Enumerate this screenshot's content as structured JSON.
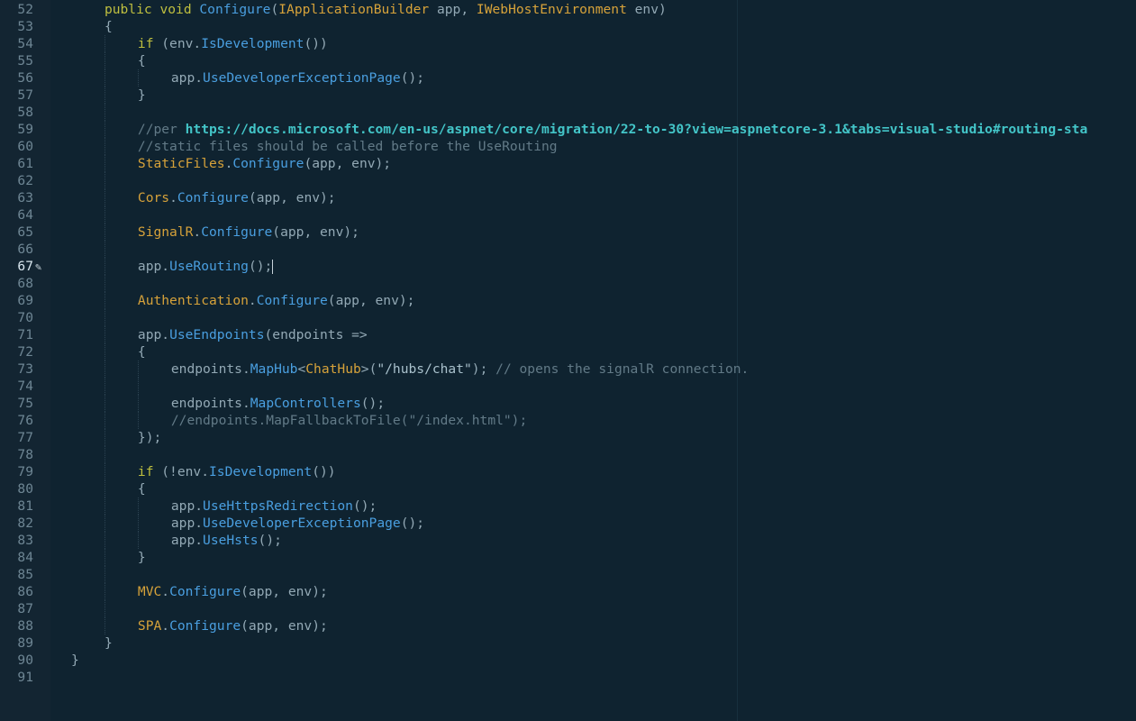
{
  "editor": {
    "active_line": 67,
    "colors": {
      "background": "#0f2330",
      "gutter": "#132532",
      "keyword": "#bfbf3f",
      "type": "#d6a23a",
      "method": "#4a9fe0",
      "comment": "#627a87",
      "url": "#43c5c8"
    },
    "lines": [
      {
        "n": "52",
        "indent": 1,
        "tokens": [
          [
            "kw",
            "public void "
          ],
          [
            "fn",
            "Configure"
          ],
          [
            "pl",
            "("
          ],
          [
            "ty",
            "IApplicationBuilder"
          ],
          [
            "pl",
            " app, "
          ],
          [
            "ty",
            "IWebHostEnvironment"
          ],
          [
            "pl",
            " env)"
          ]
        ]
      },
      {
        "n": "53",
        "indent": 1,
        "tokens": [
          [
            "pl",
            "{"
          ]
        ]
      },
      {
        "n": "54",
        "indent": 2,
        "tokens": [
          [
            "kw",
            "if"
          ],
          [
            "pl",
            " (env."
          ],
          [
            "fn",
            "IsDevelopment"
          ],
          [
            "pl",
            "())"
          ]
        ]
      },
      {
        "n": "55",
        "indent": 2,
        "tokens": [
          [
            "pl",
            "{"
          ]
        ]
      },
      {
        "n": "56",
        "indent": 3,
        "tokens": [
          [
            "pl",
            "app."
          ],
          [
            "fn",
            "UseDeveloperExceptionPage"
          ],
          [
            "pl",
            "();"
          ]
        ]
      },
      {
        "n": "57",
        "indent": 2,
        "tokens": [
          [
            "pl",
            "}"
          ]
        ]
      },
      {
        "n": "58",
        "indent": 0,
        "tokens": []
      },
      {
        "n": "59",
        "indent": 2,
        "tokens": [
          [
            "cm",
            "//per "
          ],
          [
            "ur",
            "https://docs.microsoft.com/en-us/aspnet/core/migration/22-to-30?view=aspnetcore-3.1&tabs=visual-studio#routing-sta"
          ]
        ]
      },
      {
        "n": "60",
        "indent": 2,
        "tokens": [
          [
            "cm",
            "//static files should be called before the UseRouting"
          ]
        ]
      },
      {
        "n": "61",
        "indent": 2,
        "tokens": [
          [
            "ty",
            "StaticFiles"
          ],
          [
            "pl",
            "."
          ],
          [
            "fn",
            "Configure"
          ],
          [
            "pl",
            "(app, env);"
          ]
        ]
      },
      {
        "n": "62",
        "indent": 0,
        "tokens": []
      },
      {
        "n": "63",
        "indent": 2,
        "tokens": [
          [
            "ty",
            "Cors"
          ],
          [
            "pl",
            "."
          ],
          [
            "fn",
            "Configure"
          ],
          [
            "pl",
            "(app, env);"
          ]
        ]
      },
      {
        "n": "64",
        "indent": 0,
        "tokens": []
      },
      {
        "n": "65",
        "indent": 2,
        "tokens": [
          [
            "ty",
            "SignalR"
          ],
          [
            "pl",
            "."
          ],
          [
            "fn",
            "Configure"
          ],
          [
            "pl",
            "(app, env);"
          ]
        ]
      },
      {
        "n": "66",
        "indent": 0,
        "tokens": []
      },
      {
        "n": "67",
        "indent": 2,
        "tokens": [
          [
            "pl",
            "app."
          ],
          [
            "fn",
            "UseRouting"
          ],
          [
            "pl",
            "();"
          ]
        ]
      },
      {
        "n": "68",
        "indent": 0,
        "tokens": []
      },
      {
        "n": "69",
        "indent": 2,
        "tokens": [
          [
            "ty",
            "Authentication"
          ],
          [
            "pl",
            "."
          ],
          [
            "fn",
            "Configure"
          ],
          [
            "pl",
            "(app, env);"
          ]
        ]
      },
      {
        "n": "70",
        "indent": 0,
        "tokens": []
      },
      {
        "n": "71",
        "indent": 2,
        "tokens": [
          [
            "pl",
            "app."
          ],
          [
            "fn",
            "UseEndpoints"
          ],
          [
            "pl",
            "(endpoints =>"
          ]
        ]
      },
      {
        "n": "72",
        "indent": 2,
        "tokens": [
          [
            "pl",
            "{"
          ]
        ]
      },
      {
        "n": "73",
        "indent": 3,
        "tokens": [
          [
            "pl",
            "endpoints."
          ],
          [
            "fn",
            "MapHub"
          ],
          [
            "pl",
            "<"
          ],
          [
            "ty",
            "ChatHub"
          ],
          [
            "pl",
            ">("
          ],
          [
            "st",
            "\"/hubs/chat\""
          ],
          [
            "pl",
            "); "
          ],
          [
            "cm",
            "// opens the signalR connection."
          ]
        ]
      },
      {
        "n": "74",
        "indent": 0,
        "tokens": []
      },
      {
        "n": "75",
        "indent": 3,
        "tokens": [
          [
            "pl",
            "endpoints."
          ],
          [
            "fn",
            "MapControllers"
          ],
          [
            "pl",
            "();"
          ]
        ]
      },
      {
        "n": "76",
        "indent": 3,
        "tokens": [
          [
            "cm",
            "//endpoints.MapFallbackToFile(\"/index.html\");"
          ]
        ]
      },
      {
        "n": "77",
        "indent": 2,
        "tokens": [
          [
            "pl",
            "});"
          ]
        ]
      },
      {
        "n": "78",
        "indent": 0,
        "tokens": []
      },
      {
        "n": "79",
        "indent": 2,
        "tokens": [
          [
            "kw",
            "if"
          ],
          [
            "pl",
            " (!env."
          ],
          [
            "fn",
            "IsDevelopment"
          ],
          [
            "pl",
            "())"
          ]
        ]
      },
      {
        "n": "80",
        "indent": 2,
        "tokens": [
          [
            "pl",
            "{"
          ]
        ]
      },
      {
        "n": "81",
        "indent": 3,
        "tokens": [
          [
            "pl",
            "app."
          ],
          [
            "fn",
            "UseHttpsRedirection"
          ],
          [
            "pl",
            "();"
          ]
        ]
      },
      {
        "n": "82",
        "indent": 3,
        "tokens": [
          [
            "pl",
            "app."
          ],
          [
            "fn",
            "UseDeveloperExceptionPage"
          ],
          [
            "pl",
            "();"
          ]
        ]
      },
      {
        "n": "83",
        "indent": 3,
        "tokens": [
          [
            "pl",
            "app."
          ],
          [
            "fn",
            "UseHsts"
          ],
          [
            "pl",
            "();"
          ]
        ]
      },
      {
        "n": "84",
        "indent": 2,
        "tokens": [
          [
            "pl",
            "}"
          ]
        ]
      },
      {
        "n": "85",
        "indent": 0,
        "tokens": []
      },
      {
        "n": "86",
        "indent": 2,
        "tokens": [
          [
            "ty",
            "MVC"
          ],
          [
            "pl",
            "."
          ],
          [
            "fn",
            "Configure"
          ],
          [
            "pl",
            "(app, env);"
          ]
        ]
      },
      {
        "n": "87",
        "indent": 0,
        "tokens": []
      },
      {
        "n": "88",
        "indent": 2,
        "tokens": [
          [
            "ty",
            "SPA"
          ],
          [
            "pl",
            "."
          ],
          [
            "fn",
            "Configure"
          ],
          [
            "pl",
            "(app, env);"
          ]
        ]
      },
      {
        "n": "89",
        "indent": 1,
        "tokens": [
          [
            "pl",
            "}"
          ]
        ]
      },
      {
        "n": "90",
        "indent": 0,
        "tokens": [
          [
            "pl",
            "}"
          ]
        ]
      },
      {
        "n": "91",
        "indent": 0,
        "tokens": []
      }
    ]
  }
}
